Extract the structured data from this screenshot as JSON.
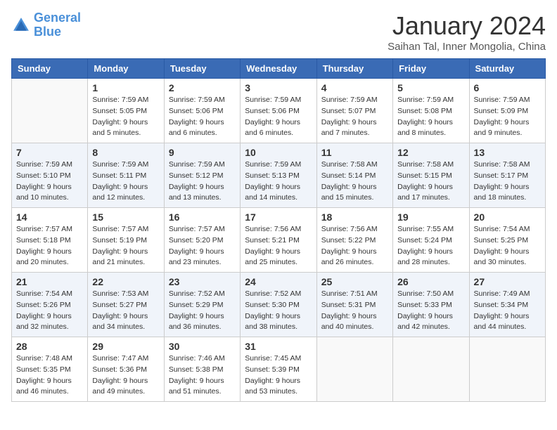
{
  "logo": {
    "line1": "General",
    "line2": "Blue"
  },
  "title": "January 2024",
  "location": "Saihan Tal, Inner Mongolia, China",
  "headers": [
    "Sunday",
    "Monday",
    "Tuesday",
    "Wednesday",
    "Thursday",
    "Friday",
    "Saturday"
  ],
  "weeks": [
    [
      {
        "day": "",
        "sunrise": "",
        "sunset": "",
        "daylight": ""
      },
      {
        "day": "1",
        "sunrise": "Sunrise: 7:59 AM",
        "sunset": "Sunset: 5:05 PM",
        "daylight": "Daylight: 9 hours and 5 minutes."
      },
      {
        "day": "2",
        "sunrise": "Sunrise: 7:59 AM",
        "sunset": "Sunset: 5:06 PM",
        "daylight": "Daylight: 9 hours and 6 minutes."
      },
      {
        "day": "3",
        "sunrise": "Sunrise: 7:59 AM",
        "sunset": "Sunset: 5:06 PM",
        "daylight": "Daylight: 9 hours and 6 minutes."
      },
      {
        "day": "4",
        "sunrise": "Sunrise: 7:59 AM",
        "sunset": "Sunset: 5:07 PM",
        "daylight": "Daylight: 9 hours and 7 minutes."
      },
      {
        "day": "5",
        "sunrise": "Sunrise: 7:59 AM",
        "sunset": "Sunset: 5:08 PM",
        "daylight": "Daylight: 9 hours and 8 minutes."
      },
      {
        "day": "6",
        "sunrise": "Sunrise: 7:59 AM",
        "sunset": "Sunset: 5:09 PM",
        "daylight": "Daylight: 9 hours and 9 minutes."
      }
    ],
    [
      {
        "day": "7",
        "sunrise": "Sunrise: 7:59 AM",
        "sunset": "Sunset: 5:10 PM",
        "daylight": "Daylight: 9 hours and 10 minutes."
      },
      {
        "day": "8",
        "sunrise": "Sunrise: 7:59 AM",
        "sunset": "Sunset: 5:11 PM",
        "daylight": "Daylight: 9 hours and 12 minutes."
      },
      {
        "day": "9",
        "sunrise": "Sunrise: 7:59 AM",
        "sunset": "Sunset: 5:12 PM",
        "daylight": "Daylight: 9 hours and 13 minutes."
      },
      {
        "day": "10",
        "sunrise": "Sunrise: 7:59 AM",
        "sunset": "Sunset: 5:13 PM",
        "daylight": "Daylight: 9 hours and 14 minutes."
      },
      {
        "day": "11",
        "sunrise": "Sunrise: 7:58 AM",
        "sunset": "Sunset: 5:14 PM",
        "daylight": "Daylight: 9 hours and 15 minutes."
      },
      {
        "day": "12",
        "sunrise": "Sunrise: 7:58 AM",
        "sunset": "Sunset: 5:15 PM",
        "daylight": "Daylight: 9 hours and 17 minutes."
      },
      {
        "day": "13",
        "sunrise": "Sunrise: 7:58 AM",
        "sunset": "Sunset: 5:17 PM",
        "daylight": "Daylight: 9 hours and 18 minutes."
      }
    ],
    [
      {
        "day": "14",
        "sunrise": "Sunrise: 7:57 AM",
        "sunset": "Sunset: 5:18 PM",
        "daylight": "Daylight: 9 hours and 20 minutes."
      },
      {
        "day": "15",
        "sunrise": "Sunrise: 7:57 AM",
        "sunset": "Sunset: 5:19 PM",
        "daylight": "Daylight: 9 hours and 21 minutes."
      },
      {
        "day": "16",
        "sunrise": "Sunrise: 7:57 AM",
        "sunset": "Sunset: 5:20 PM",
        "daylight": "Daylight: 9 hours and 23 minutes."
      },
      {
        "day": "17",
        "sunrise": "Sunrise: 7:56 AM",
        "sunset": "Sunset: 5:21 PM",
        "daylight": "Daylight: 9 hours and 25 minutes."
      },
      {
        "day": "18",
        "sunrise": "Sunrise: 7:56 AM",
        "sunset": "Sunset: 5:22 PM",
        "daylight": "Daylight: 9 hours and 26 minutes."
      },
      {
        "day": "19",
        "sunrise": "Sunrise: 7:55 AM",
        "sunset": "Sunset: 5:24 PM",
        "daylight": "Daylight: 9 hours and 28 minutes."
      },
      {
        "day": "20",
        "sunrise": "Sunrise: 7:54 AM",
        "sunset": "Sunset: 5:25 PM",
        "daylight": "Daylight: 9 hours and 30 minutes."
      }
    ],
    [
      {
        "day": "21",
        "sunrise": "Sunrise: 7:54 AM",
        "sunset": "Sunset: 5:26 PM",
        "daylight": "Daylight: 9 hours and 32 minutes."
      },
      {
        "day": "22",
        "sunrise": "Sunrise: 7:53 AM",
        "sunset": "Sunset: 5:27 PM",
        "daylight": "Daylight: 9 hours and 34 minutes."
      },
      {
        "day": "23",
        "sunrise": "Sunrise: 7:52 AM",
        "sunset": "Sunset: 5:29 PM",
        "daylight": "Daylight: 9 hours and 36 minutes."
      },
      {
        "day": "24",
        "sunrise": "Sunrise: 7:52 AM",
        "sunset": "Sunset: 5:30 PM",
        "daylight": "Daylight: 9 hours and 38 minutes."
      },
      {
        "day": "25",
        "sunrise": "Sunrise: 7:51 AM",
        "sunset": "Sunset: 5:31 PM",
        "daylight": "Daylight: 9 hours and 40 minutes."
      },
      {
        "day": "26",
        "sunrise": "Sunrise: 7:50 AM",
        "sunset": "Sunset: 5:33 PM",
        "daylight": "Daylight: 9 hours and 42 minutes."
      },
      {
        "day": "27",
        "sunrise": "Sunrise: 7:49 AM",
        "sunset": "Sunset: 5:34 PM",
        "daylight": "Daylight: 9 hours and 44 minutes."
      }
    ],
    [
      {
        "day": "28",
        "sunrise": "Sunrise: 7:48 AM",
        "sunset": "Sunset: 5:35 PM",
        "daylight": "Daylight: 9 hours and 46 minutes."
      },
      {
        "day": "29",
        "sunrise": "Sunrise: 7:47 AM",
        "sunset": "Sunset: 5:36 PM",
        "daylight": "Daylight: 9 hours and 49 minutes."
      },
      {
        "day": "30",
        "sunrise": "Sunrise: 7:46 AM",
        "sunset": "Sunset: 5:38 PM",
        "daylight": "Daylight: 9 hours and 51 minutes."
      },
      {
        "day": "31",
        "sunrise": "Sunrise: 7:45 AM",
        "sunset": "Sunset: 5:39 PM",
        "daylight": "Daylight: 9 hours and 53 minutes."
      },
      {
        "day": "",
        "sunrise": "",
        "sunset": "",
        "daylight": ""
      },
      {
        "day": "",
        "sunrise": "",
        "sunset": "",
        "daylight": ""
      },
      {
        "day": "",
        "sunrise": "",
        "sunset": "",
        "daylight": ""
      }
    ]
  ]
}
